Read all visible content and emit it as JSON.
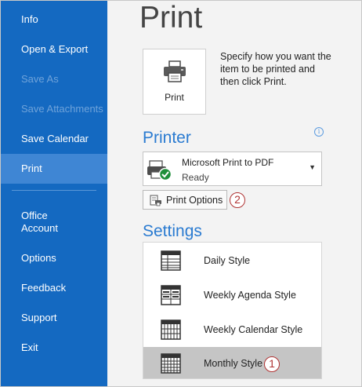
{
  "sidebar": {
    "items": [
      {
        "label": "Info",
        "state": "normal"
      },
      {
        "label": "Open & Export",
        "state": "normal"
      },
      {
        "label": "Save As",
        "state": "disabled"
      },
      {
        "label": "Save Attachments",
        "state": "disabled"
      },
      {
        "label": "Save Calendar",
        "state": "normal"
      },
      {
        "label": "Print",
        "state": "active"
      },
      {
        "label": "Office\nAccount",
        "state": "normal"
      },
      {
        "label": "Options",
        "state": "normal"
      },
      {
        "label": "Feedback",
        "state": "normal"
      },
      {
        "label": "Support",
        "state": "normal"
      },
      {
        "label": "Exit",
        "state": "normal"
      }
    ]
  },
  "main": {
    "title": "Print",
    "print_button": {
      "label": "Print",
      "icon": "printer-icon"
    },
    "description": "Specify how you want the item to be printed and then click Print.",
    "printer": {
      "heading": "Printer",
      "name": "Microsoft Print to PDF",
      "status": "Ready",
      "info_icon": "info-icon"
    },
    "print_options": {
      "label": "Print Options",
      "callout": "2"
    },
    "settings": {
      "heading": "Settings",
      "styles": [
        {
          "label": "Daily Style",
          "icon": "daily-style-icon"
        },
        {
          "label": "Weekly Agenda Style",
          "icon": "weekly-agenda-icon"
        },
        {
          "label": "Weekly Calendar Style",
          "icon": "weekly-calendar-icon"
        },
        {
          "label": "Monthly Style",
          "icon": "monthly-style-icon",
          "selected": true
        }
      ],
      "callout": "1"
    }
  },
  "colors": {
    "sidebar": "#1469c1",
    "sidebar_active": "#3f86d4",
    "accent": "#2a7bd1",
    "callout": "#b03434",
    "selected_row": "#c5c5c5"
  }
}
